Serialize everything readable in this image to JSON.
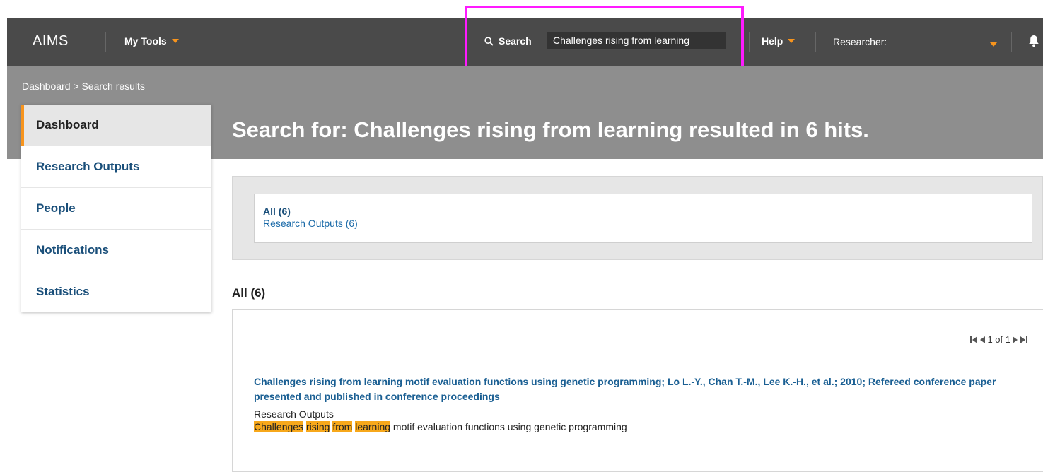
{
  "header": {
    "brand": "AIMS",
    "my_tools": "My Tools",
    "search_label": "Search",
    "search_value": "Challenges rising from learning",
    "help": "Help",
    "researcher": "Researcher:"
  },
  "breadcrumb": {
    "dashboard": "Dashboard",
    "separator": " > ",
    "current": "Search results"
  },
  "sidebar": {
    "items": [
      {
        "label": "Dashboard"
      },
      {
        "label": "Research Outputs"
      },
      {
        "label": "People"
      },
      {
        "label": "Notifications"
      },
      {
        "label": "Statistics"
      }
    ]
  },
  "main": {
    "title": "Search for: Challenges rising from learning resulted in 6 hits.",
    "filters": {
      "all": "All (6)",
      "research_outputs": "Research Outputs (6)"
    },
    "section_title": "All (6)",
    "pager": "1 of 1",
    "results": [
      {
        "title": "Challenges rising from learning motif evaluation functions using genetic programming; Lo L.-Y., Chan T.-M., Lee K.-H., et al.; 2010; Refereed conference paper presented and published in conference proceedings",
        "type": "Research Outputs",
        "snippet": {
          "hl1": "Challenges",
          "hl2": "rising",
          "hl3": "from",
          "hl4": "learning",
          "rest": " motif evaluation functions using genetic programming"
        }
      }
    ]
  },
  "colors": {
    "topbar": "#4a4a4a",
    "band": "#8e8e8e",
    "accent": "#f7941d",
    "link": "#1a4f7a",
    "highlight": "#f7a81b",
    "annotation_box": "#ff1aff"
  }
}
